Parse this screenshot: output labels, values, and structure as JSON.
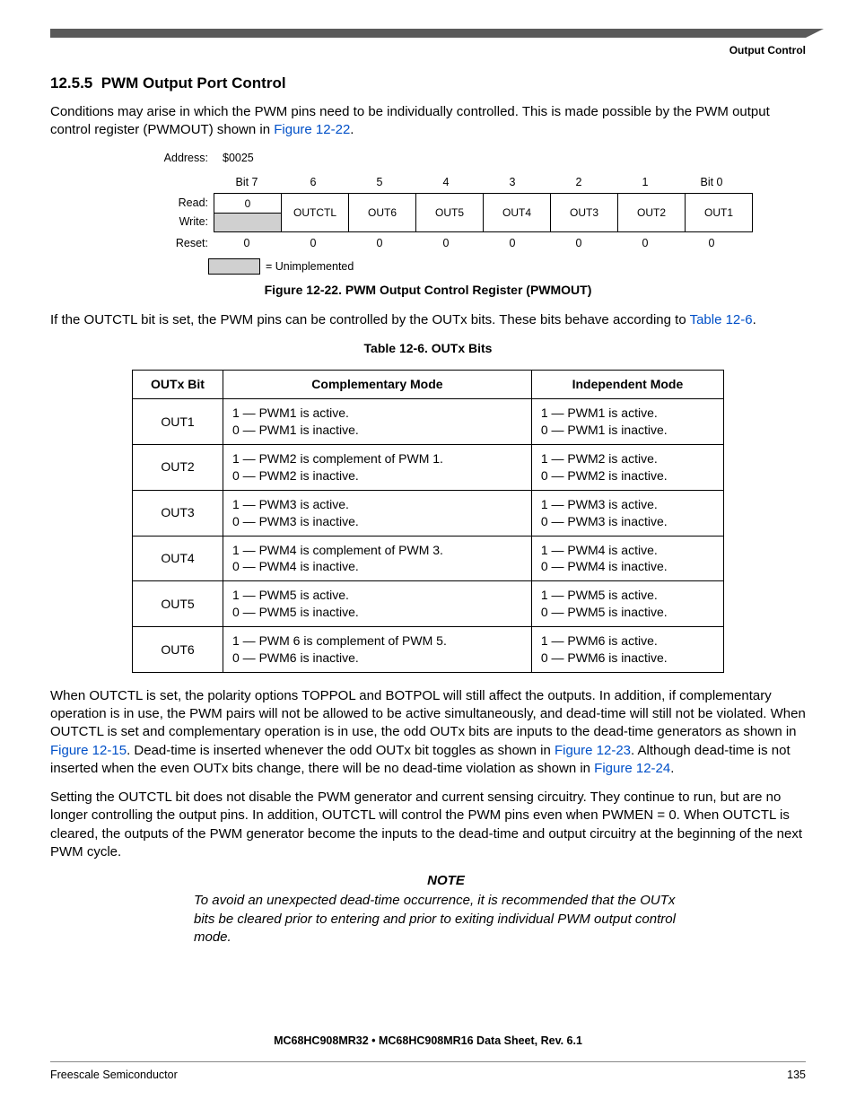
{
  "header": {
    "section_label": "Output Control"
  },
  "section": {
    "number": "12.5.5",
    "title": "PWM Output Port Control",
    "intro_a": "Conditions may arise in which the PWM pins need to be individually controlled. This is made possible by the PWM output control register (PWMOUT) shown in ",
    "intro_ref": "Figure 12-22",
    "intro_b": "."
  },
  "register": {
    "address_label": "Address:",
    "address": "$0025",
    "bit_labels": [
      "Bit 7",
      "6",
      "5",
      "4",
      "3",
      "2",
      "1",
      "Bit 0"
    ],
    "read_label": "Read:",
    "write_label": "Write:",
    "reset_label": "Reset:",
    "bit7_read": "0",
    "fields": [
      "OUTCTL",
      "OUT6",
      "OUT5",
      "OUT4",
      "OUT3",
      "OUT2",
      "OUT1"
    ],
    "reset_values": [
      "0",
      "0",
      "0",
      "0",
      "0",
      "0",
      "0",
      "0"
    ],
    "legend": "= Unimplemented"
  },
  "figure_caption": "Figure 12-22. PWM Output Control Register (PWMOUT)",
  "para2_a": "If the OUTCTL bit is set, the PWM pins can be controlled by the OUTx bits. These bits behave according to ",
  "para2_ref": "Table 12-6",
  "para2_b": ".",
  "table": {
    "caption": "Table 12-6. OUTx Bits",
    "headers": [
      "OUTx Bit",
      "Complementary Mode",
      "Independent Mode"
    ],
    "rows": [
      {
        "bit": "OUT1",
        "comp": [
          "1 — PWM1 is active.",
          "0 — PWM1 is inactive."
        ],
        "ind": [
          "1 — PWM1 is active.",
          "0 — PWM1 is inactive."
        ]
      },
      {
        "bit": "OUT2",
        "comp": [
          "1 — PWM2 is complement of PWM 1.",
          "0 — PWM2 is inactive."
        ],
        "ind": [
          "1 — PWM2 is active.",
          "0 — PWM2 is inactive."
        ]
      },
      {
        "bit": "OUT3",
        "comp": [
          "1 — PWM3 is active.",
          "0 — PWM3 is inactive."
        ],
        "ind": [
          "1 — PWM3 is active.",
          "0 — PWM3 is inactive."
        ]
      },
      {
        "bit": "OUT4",
        "comp": [
          "1 — PWM4 is complement of PWM 3.",
          "0 — PWM4 is inactive."
        ],
        "ind": [
          "1 — PWM4 is active.",
          "0 — PWM4 is inactive."
        ]
      },
      {
        "bit": "OUT5",
        "comp": [
          "1 — PWM5 is active.",
          "0 — PWM5 is inactive."
        ],
        "ind": [
          "1 — PWM5 is active.",
          "0 — PWM5 is inactive."
        ]
      },
      {
        "bit": "OUT6",
        "comp": [
          "1 — PWM 6 is complement of PWM 5.",
          "0 — PWM6 is inactive."
        ],
        "ind": [
          "1 — PWM6 is active.",
          "0 — PWM6 is inactive."
        ]
      }
    ]
  },
  "para3": {
    "a": "When OUTCTL is set, the polarity options TOPPOL and BOTPOL will still affect the outputs. In addition, if complementary operation is in use, the PWM pairs will not be allowed to be active simultaneously, and dead-time will still not be violated. When OUTCTL is set and complementary operation is in use, the odd OUTx bits are inputs to the dead-time generators as shown in ",
    "ref1": "Figure 12-15",
    "b": ". Dead-time is inserted whenever the odd OUTx bit toggles as shown in ",
    "ref2": "Figure 12-23",
    "c": ". Although dead-time is not inserted when the even OUTx bits change, there will be no dead-time violation as shown in ",
    "ref3": "Figure 12-24",
    "d": "."
  },
  "para4": "Setting the OUTCTL bit does not disable the PWM generator and current sensing circuitry. They continue to run, but are no longer controlling the output pins. In addition, OUTCTL will control the PWM pins even when PWMEN = 0. When OUTCTL is cleared, the outputs of the PWM generator become the inputs to the dead-time and output circuitry at the beginning of the next PWM cycle.",
  "note": {
    "label": "NOTE",
    "text": "To avoid an unexpected dead-time occurrence, it is recommended that the OUTx bits be cleared prior to entering and prior to exiting individual PWM output control mode."
  },
  "footer": {
    "docline": "MC68HC908MR32 • MC68HC908MR16 Data Sheet, Rev. 6.1",
    "left": "Freescale Semiconductor",
    "right": "135"
  }
}
